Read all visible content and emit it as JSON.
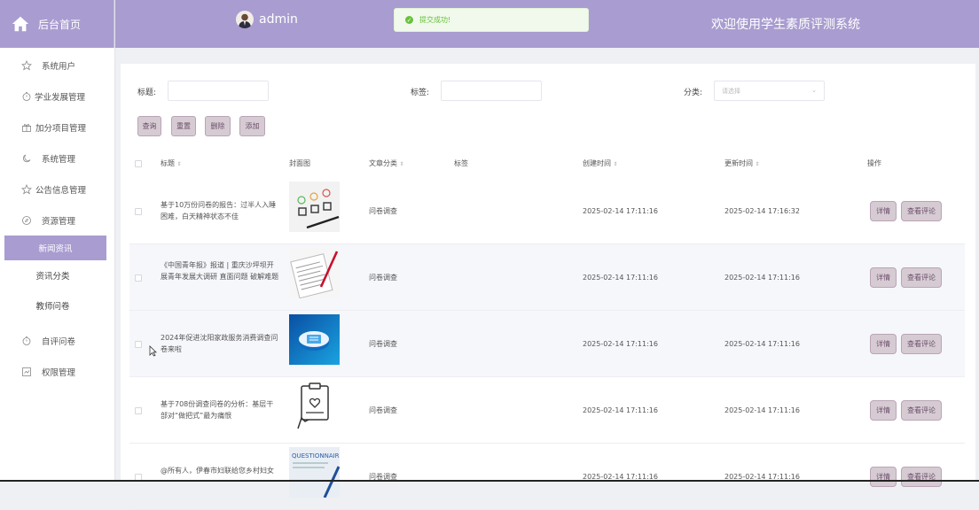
{
  "brand": {
    "label": "后台首页"
  },
  "header": {
    "username": "admin",
    "welcome": "欢迎使用学生素质评测系统"
  },
  "toast": {
    "message": "提交成功!"
  },
  "sidebar": {
    "items": [
      {
        "label": "系统用户",
        "icon": "star-icon"
      },
      {
        "label": "学业发展管理",
        "icon": "timer-icon"
      },
      {
        "label": "加分项目管理",
        "icon": "gift-icon"
      },
      {
        "label": "系统管理",
        "icon": "moon-icon"
      },
      {
        "label": "公告信息管理",
        "icon": "star-icon"
      },
      {
        "label": "资源管理",
        "icon": "compass-icon"
      }
    ],
    "sub_items": [
      "新闻资讯",
      "资讯分类",
      "教师问卷"
    ],
    "items_after": [
      {
        "label": "自评问卷",
        "icon": "timer-icon"
      },
      {
        "label": "权限管理",
        "icon": "chart-icon"
      }
    ]
  },
  "filters": {
    "title_label": "标题:",
    "tag_label": "标签:",
    "category_label": "分类:",
    "category_placeholder": "请选择"
  },
  "buttons": {
    "query": "查询",
    "reset": "重置",
    "delete": "删除",
    "add": "添加"
  },
  "table": {
    "headers": {
      "title": "标题",
      "cover": "封面图",
      "category": "文章分类",
      "tag": "标签",
      "created": "创建时间",
      "updated": "更新时间",
      "actions": "操作"
    },
    "actions": {
      "detail": "详情",
      "review": "查看评论"
    },
    "rows": [
      {
        "title": "基于10万份问卷的报告：过半人入睡困难，白天精神状态不佳",
        "category": "问卷调查",
        "created": "2025-02-14 17:11:16",
        "updated": "2025-02-14 17:16:32"
      },
      {
        "title": "《中国青年报》报道 | 重庆沙坪坝开展青年发展大调研 直面问题 破解难题",
        "category": "问卷调查",
        "created": "2025-02-14 17:11:16",
        "updated": "2025-02-14 17:11:16"
      },
      {
        "title": "2024年促进沈阳家政服务消费调查问卷来啦",
        "category": "问卷调查",
        "created": "2025-02-14 17:11:16",
        "updated": "2025-02-14 17:11:16"
      },
      {
        "title": "基于708份调查问卷的分析：基层干部对“做把式”最为痛恨",
        "category": "问卷调查",
        "created": "2025-02-14 17:11:16",
        "updated": "2025-02-14 17:11:16"
      },
      {
        "title": "@所有人，伊春市妇联给您乡村妇女",
        "category": "问卷调查",
        "created": "2025-02-14 17:11:16",
        "updated": "2025-02-14 17:11:16"
      }
    ]
  },
  "thumbs": {
    "questionnaire_text": "QUESTIONNAIRE"
  }
}
